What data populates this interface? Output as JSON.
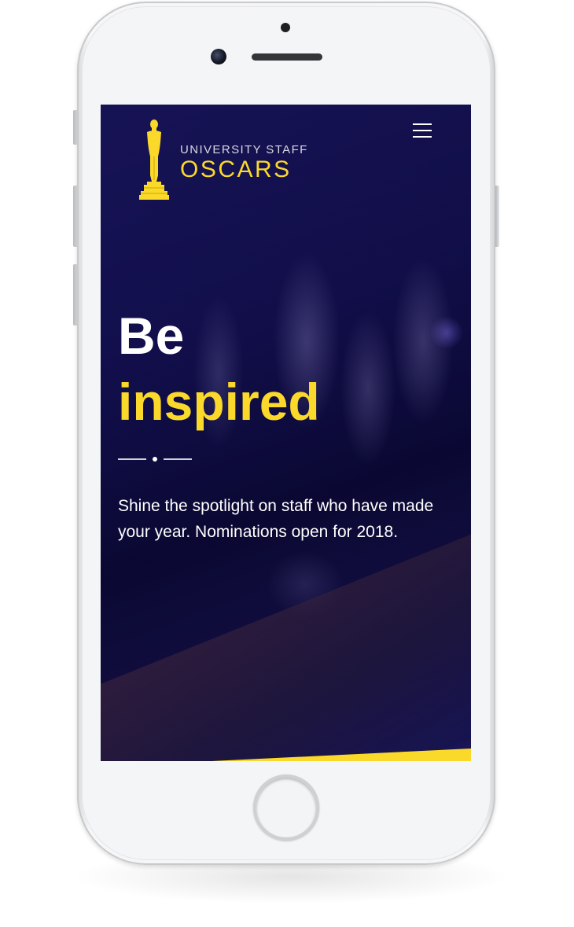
{
  "header": {
    "logo": {
      "line1": "UNIVERSITY STAFF",
      "line2": "OSCARS",
      "icon": "oscar-statuette-icon"
    },
    "menu_icon": "hamburger-menu-icon"
  },
  "hero": {
    "title_line1": "Be",
    "title_line2": "inspired",
    "description": "Shine the spotlight on staff who have made your year. Nominations open for 2018."
  },
  "colors": {
    "accent_yellow": "#fbd92a",
    "background_navy": "#0d0b3c",
    "text_white": "#ffffff"
  }
}
